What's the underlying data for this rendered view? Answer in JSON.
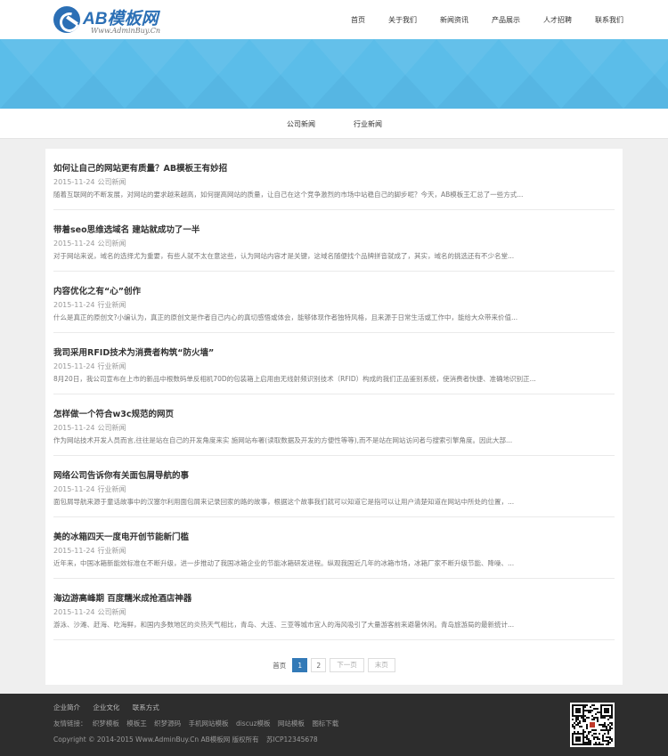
{
  "brand": {
    "logo_text": "AB模板网",
    "logo_sub": "Www.AdminBuy.Cn"
  },
  "nav": {
    "items": [
      "首页",
      "关于我们",
      "新闻资讯",
      "产品展示",
      "人才招聘",
      "联系我们"
    ]
  },
  "subnav": {
    "items": [
      "公司新闻",
      "行业新闻"
    ]
  },
  "news": [
    {
      "title": "如何让自己的网站更有质量？AB模板王有妙招",
      "date": "2015-11-24",
      "category": "公司新闻",
      "summary": "随着互联网的不断发展，对网站的要求越来越高，如何提高网站的质量，让自己在这个竞争激烈的市场中站稳自己的脚步呢？今天，AB模板王汇总了一些方式..."
    },
    {
      "title": "带着seo思维选域名 建站就成功了一半",
      "date": "2015-11-24",
      "category": "公司新闻",
      "summary": "对于网站来说，域名的选择尤为重要，有些人就不太在意这些，认为网站内容才是关键，这域名随便找个品牌拼音就成了，其实，域名的挑选还有不少名堂..."
    },
    {
      "title": "内容优化之有“心”创作",
      "date": "2015-11-24",
      "category": "行业新闻",
      "summary": "什么是真正的原创文?小编认为，真正的原创文是作者自己内心的真切感悟或体会，能够体现作者独特风格，且来源于日常生活或工作中，能给大众带来价值..."
    },
    {
      "title": "我司采用RFID技术为消费者构筑“防火墙”",
      "date": "2015-11-24",
      "category": "行业新闻",
      "summary": "8月20日，我公司宣布在上市的新品中根数码单反相机70D的包装箱上启用由无线射频识别技术（RFID）构成的我们正品鉴别系统，使消费者快捷、准确地识别正..."
    },
    {
      "title": "怎样做一个符合w3c规范的网页",
      "date": "2015-11-24",
      "category": "公司新闻",
      "summary": "作为网站技术开发人员而言,往往是站在自己的开发角度来实 施网站布署(读取数据及开发的方便性等等),而不是站在网站访问者与搜索引擎角度。因此大部..."
    },
    {
      "title": "网络公司告诉你有关面包屑导航的事",
      "date": "2015-11-24",
      "category": "行业新闻",
      "summary": "面包屑导航来源于童话故事中的汉塞尔利用面包屑来记录回家的路的故事，根据这个故事我们就可以知道它是指可以让用户清楚知道在网站中所处的位置，..."
    },
    {
      "title": "美的冰箱四天一度电开创节能新门槛",
      "date": "2015-11-24",
      "category": "行业新闻",
      "summary": "近年来，中国冰箱新能效标准在不断升级，进一步推动了我国冰箱企业的节能冰箱研发进程。纵观我国近几年的冰箱市场，冰箱厂家不断升级节能、降噪、..."
    },
    {
      "title": "海边游高峰期 百度糯米成抢酒店神器",
      "date": "2015-11-24",
      "category": "公司新闻",
      "summary": "游泳、沙滩、赶海、吃海鲜，和国内多数地区的炎热天气相比，青岛、大连、三亚等城市宜人的海风吸引了大量游客前来避暑休闲。青岛旅游局的最新统计..."
    }
  ],
  "pager": {
    "first": "首页",
    "pages": [
      "1",
      "2"
    ],
    "current": "1",
    "next": "下一页",
    "last": "末页"
  },
  "footer": {
    "links": [
      "企业简介",
      "企业文化",
      "联系方式"
    ],
    "friends_label": "友情链接：",
    "friends": [
      "织梦模板",
      "模板王",
      "织梦源码",
      "手机网站模板",
      "discuz模板",
      "网站模板",
      "图标下载"
    ],
    "copyright": "Copyright © 2014-2015 Www.AdminBuy.Cn AB模板网 版权所有",
    "icp": "苏ICP12345678"
  },
  "colors": {
    "brand": "#2b6fb5",
    "banner": "#5bbde9",
    "page_active": "#337ab7",
    "footer_bg": "#2d2d2d"
  }
}
